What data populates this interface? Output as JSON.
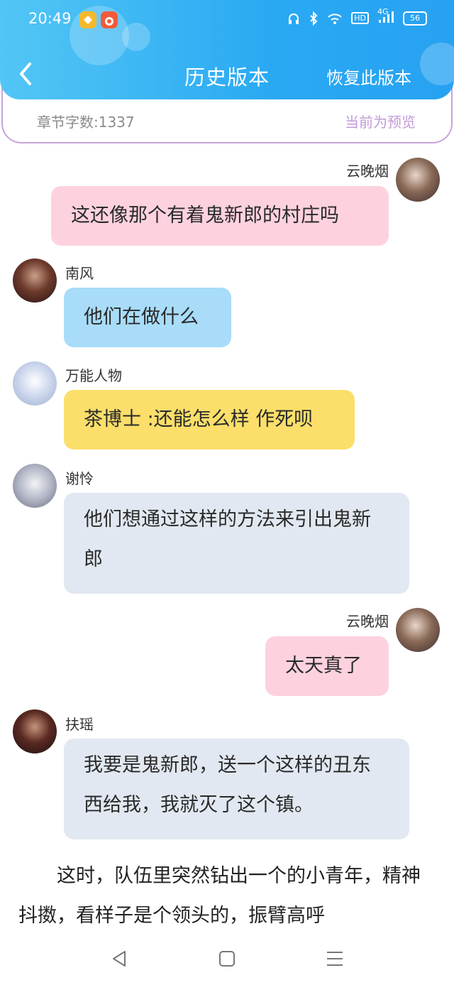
{
  "status": {
    "time": "20:49",
    "network": "4G",
    "battery": "56",
    "hd": "HD"
  },
  "header": {
    "title": "历史版本",
    "restore_label": "恢复此版本"
  },
  "info": {
    "word_count": "章节字数:1337",
    "preview_label": "当前为预览"
  },
  "messages": [
    {
      "name": "云晚烟",
      "text": "这还像那个有着鬼新郎的村庄吗"
    },
    {
      "name": "南风",
      "text": "他们在做什么"
    },
    {
      "name": "万能人物",
      "text": "茶博士 :还能怎么样 作死呗"
    },
    {
      "name": "谢怜",
      "text": "他们想通过这样的方法来引出鬼新郎"
    },
    {
      "name": "云晚烟",
      "text": "太天真了"
    },
    {
      "name": "扶瑶",
      "text": "我要是鬼新郎，送一个这样的丑东西给我，我就灭了这个镇。"
    }
  ],
  "narrative": "这时，队伍里突然钻出一个的小青年，精神抖擞，看样子是个领头的，振臂高呼",
  "colors": {
    "header": "#2aa9f3",
    "pink": "#fdd2de",
    "blue": "#a8dcf9",
    "yellow": "#fbdf6a",
    "gray": "#e2e8f1",
    "accent": "#c39ad8"
  }
}
